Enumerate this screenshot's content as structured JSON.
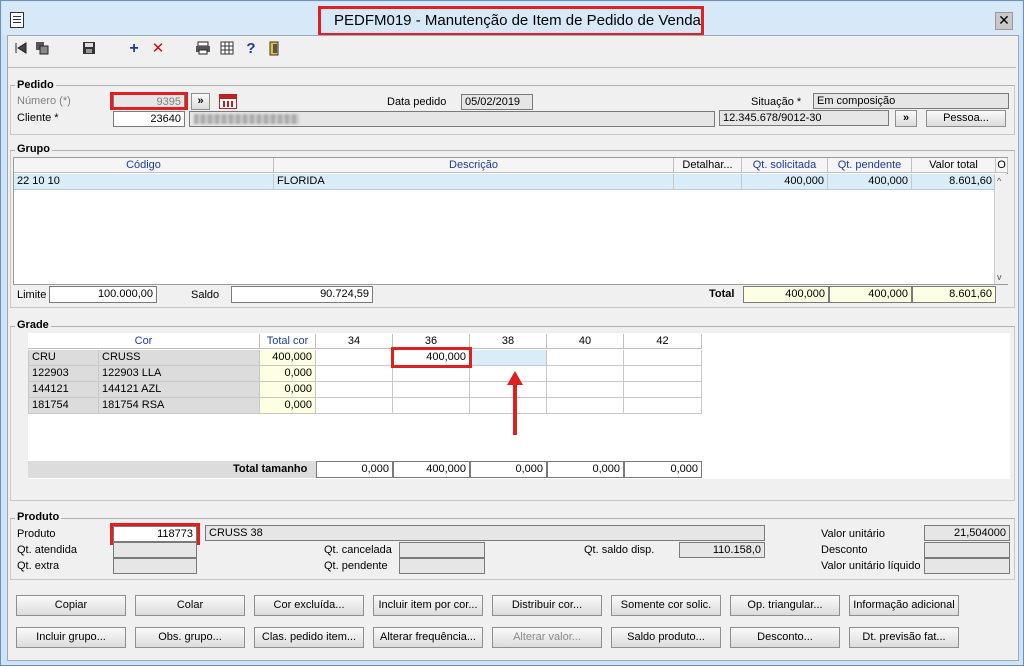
{
  "window": {
    "title": "PEDFM019 - Manutenção de Item de Pedido de Venda",
    "close": "✕"
  },
  "toolbar": {
    "icons": [
      "first-record-icon",
      "copy-record-icon",
      "save-icon",
      "add-icon",
      "delete-icon",
      "print-icon",
      "calculator-icon",
      "help-icon",
      "exit-icon"
    ]
  },
  "pedido": {
    "group_label": "Pedido",
    "numero_label": "Número (*)",
    "numero_value": "9395",
    "nav_button": "»",
    "data_label": "Data pedido",
    "data_value": "05/02/2019",
    "situacao_label": "Situação *",
    "situacao_value": "Em composição",
    "cliente_label": "Cliente *",
    "cliente_value": "23640",
    "cnpj_value": "12.345.678/9012-30",
    "cnpj_button": "»",
    "pessoa_button": "Pessoa..."
  },
  "grupo": {
    "group_label": "Grupo",
    "columns": [
      "Código",
      "Descrição",
      "Detalhar...",
      "Qt. solicitada",
      "Qt. pendente",
      "Valor total",
      "O"
    ],
    "rows": [
      {
        "codigo": "22 10 10",
        "descricao": "FLORIDA",
        "detalhar": "",
        "qt_solicitada": "400,000",
        "qt_pendente": "400,000",
        "valor_total": "8.601,60"
      }
    ],
    "limite_label": "Limite",
    "limite_value": "100.000,00",
    "saldo_label": "Saldo",
    "saldo_value": "90.724,59",
    "total_label": "Total",
    "total_solicitada": "400,000",
    "total_pendente": "400,000",
    "total_valor": "8.601,60"
  },
  "grade": {
    "group_label": "Grade",
    "cor_header": "Cor",
    "total_cor_header": "Total cor",
    "sizes": [
      "34",
      "36",
      "38",
      "40",
      "42"
    ],
    "rows": [
      {
        "code": "CRU",
        "name": "CRUSS",
        "total": "400,000",
        "values": [
          "",
          "400,000",
          "",
          "",
          ""
        ]
      },
      {
        "code": "122903",
        "name": "122903 LLA",
        "total": "0,000",
        "values": [
          "",
          "",
          "",
          "",
          ""
        ]
      },
      {
        "code": "144121",
        "name": "144121 AZL",
        "total": "0,000",
        "values": [
          "",
          "",
          "",
          "",
          ""
        ]
      },
      {
        "code": "181754",
        "name": "181754 RSA",
        "total": "0,000",
        "values": [
          "",
          "",
          "",
          "",
          ""
        ]
      }
    ],
    "total_tamanho_label": "Total tamanho",
    "total_tamanho_values": [
      "0,000",
      "400,000",
      "0,000",
      "0,000",
      "0,000"
    ]
  },
  "produto": {
    "group_label": "Produto",
    "produto_label": "Produto",
    "produto_value": "118773",
    "produto_desc": "CRUSS 38",
    "qt_atendida_label": "Qt. atendida",
    "qt_extra_label": "Qt. extra",
    "qt_cancelada_label": "Qt. cancelada",
    "qt_pendente_label": "Qt. pendente",
    "qt_saldo_label": "Qt. saldo disp.",
    "qt_saldo_value": "110.158,0",
    "valor_unitario_label": "Valor unitário",
    "valor_unitario_value": "21,504000",
    "desconto_label": "Desconto",
    "valor_liquido_label": "Valor unitário líquido"
  },
  "buttons": {
    "row1": [
      "Copiar",
      "Colar",
      "Cor excluída...",
      "Incluir item por cor...",
      "Distribuir cor...",
      "Somente cor solic.",
      "Op. triangular...",
      "Informação adicional"
    ],
    "row2": [
      "Incluir grupo...",
      "Obs. grupo...",
      "Clas. pedido item...",
      "Alterar frequência...",
      "Alterar valor...",
      "Saldo produto...",
      "Desconto...",
      "Dt. previsão fat..."
    ]
  },
  "colors": {
    "highlight": "#e02020",
    "selected_row": "#d8ecfa",
    "yellow_cell": "#fefee2",
    "arrow": "#e02020"
  }
}
